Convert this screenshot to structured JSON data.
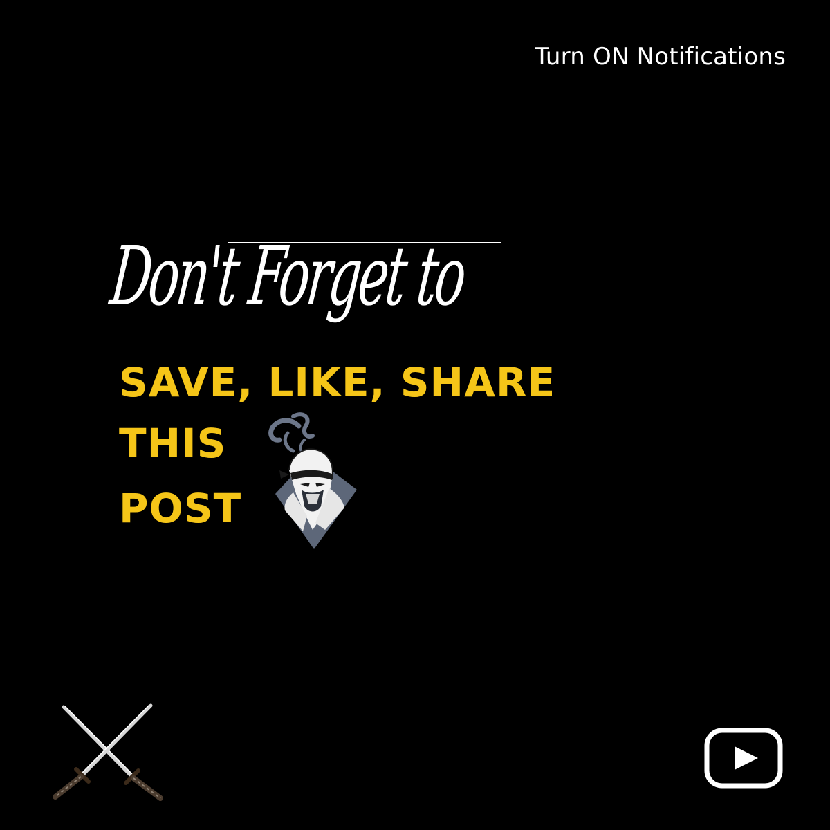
{
  "notification": {
    "text": "Turn ON Notifications"
  },
  "headline": {
    "script_text": "Don't Forget to"
  },
  "cta": {
    "line1": "SAVE, LIKE, SHARE",
    "line2": "THIS",
    "line3": "POST"
  },
  "icons": {
    "ninja": "ninja-logo-icon",
    "swords": "crossed-katanas-icon",
    "play": "youtube-play-icon"
  },
  "colors": {
    "background": "#000000",
    "accent": "#f5c518",
    "text": "#ffffff",
    "ninja": "#5d6779"
  }
}
